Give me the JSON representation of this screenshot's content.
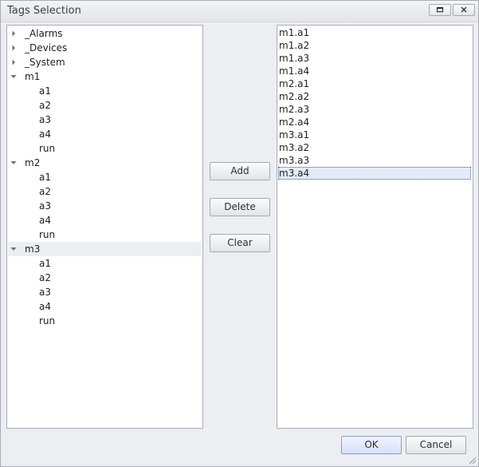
{
  "window": {
    "title": "Tags Selection"
  },
  "tree": {
    "items": [
      {
        "label": "_Alarms",
        "level": 0,
        "state": "collapsed"
      },
      {
        "label": "_Devices",
        "level": 0,
        "state": "collapsed"
      },
      {
        "label": "_System",
        "level": 0,
        "state": "collapsed"
      },
      {
        "label": "m1",
        "level": 0,
        "state": "expanded"
      },
      {
        "label": "a1",
        "level": 1
      },
      {
        "label": "a2",
        "level": 1
      },
      {
        "label": "a3",
        "level": 1
      },
      {
        "label": "a4",
        "level": 1
      },
      {
        "label": "run",
        "level": 1
      },
      {
        "label": "m2",
        "level": 0,
        "state": "expanded"
      },
      {
        "label": "a1",
        "level": 1
      },
      {
        "label": "a2",
        "level": 1
      },
      {
        "label": "a3",
        "level": 1
      },
      {
        "label": "a4",
        "level": 1
      },
      {
        "label": "run",
        "level": 1
      },
      {
        "label": "m3",
        "level": 0,
        "state": "expanded",
        "hover": true
      },
      {
        "label": "a1",
        "level": 1
      },
      {
        "label": "a2",
        "level": 1
      },
      {
        "label": "a3",
        "level": 1
      },
      {
        "label": "a4",
        "level": 1
      },
      {
        "label": "run",
        "level": 1
      }
    ]
  },
  "selected_list": {
    "items": [
      "m1.a1",
      "m1.a2",
      "m1.a3",
      "m1.a4",
      "m2.a1",
      "m2.a2",
      "m2.a3",
      "m2.a4",
      "m3.a1",
      "m3.a2",
      "m3.a3",
      "m3.a4"
    ],
    "selected_index": 11
  },
  "actions": {
    "add_label": "Add",
    "delete_label": "Delete",
    "clear_label": "Clear"
  },
  "footer": {
    "ok_label": "OK",
    "cancel_label": "Cancel"
  },
  "icons": {
    "restore": "restore-icon",
    "close": "close-icon",
    "collapsed": "triangle-right-icon",
    "expanded": "triangle-down-icon",
    "resize": "resize-grip-icon"
  }
}
